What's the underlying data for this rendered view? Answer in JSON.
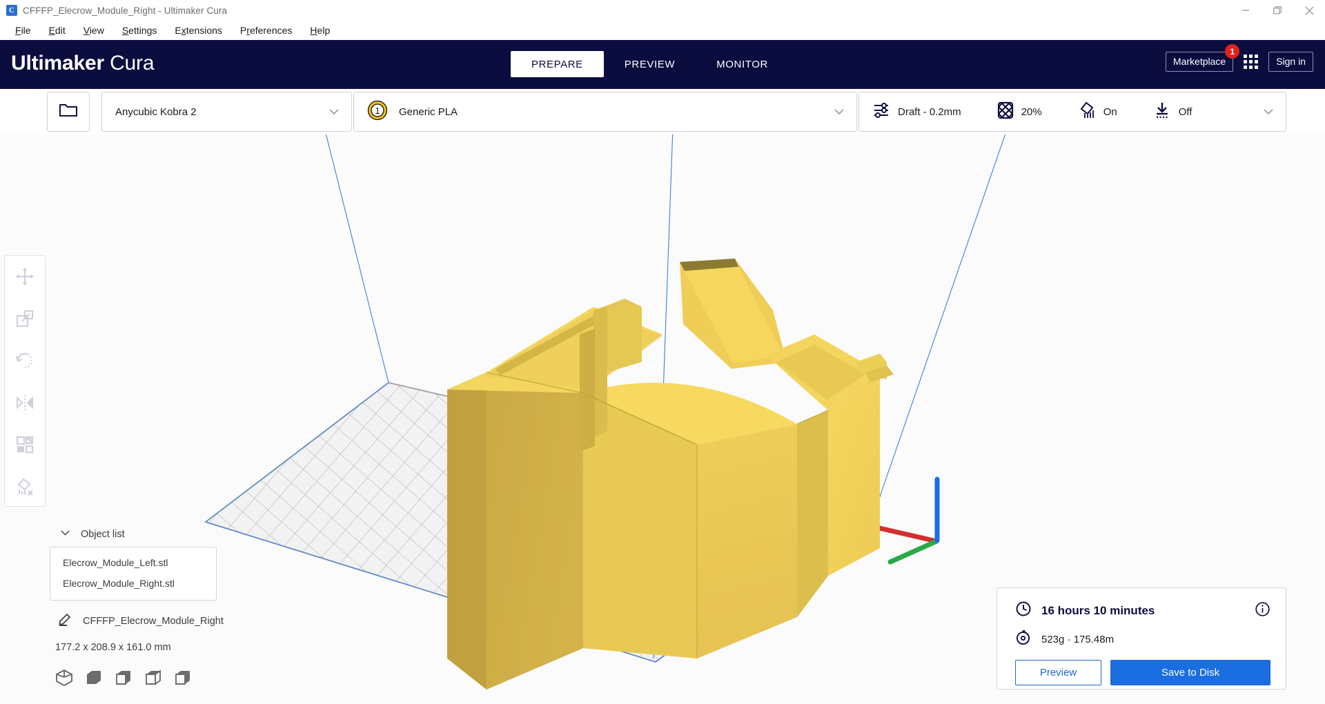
{
  "window": {
    "title": "CFFFP_Elecrow_Module_Right - Ultimaker Cura",
    "app_icon": "cura-app-icon",
    "minimize": "minimize-icon",
    "maximize": "restore-icon",
    "close": "close-icon"
  },
  "menubar": {
    "items": [
      {
        "pre": "",
        "accel": "F",
        "post": "ile"
      },
      {
        "pre": "",
        "accel": "E",
        "post": "dit"
      },
      {
        "pre": "",
        "accel": "V",
        "post": "iew"
      },
      {
        "pre": "",
        "accel": "S",
        "post": "ettings"
      },
      {
        "pre": "E",
        "accel": "x",
        "post": "tensions"
      },
      {
        "pre": "P",
        "accel": "r",
        "post": "eferences"
      },
      {
        "pre": "",
        "accel": "H",
        "post": "elp"
      }
    ]
  },
  "header": {
    "logo_bold": "Ultimaker",
    "logo_light": "Cura",
    "background_color": "#0c0d3f",
    "tabs": [
      {
        "label": "PREPARE",
        "active": true
      },
      {
        "label": "PREVIEW",
        "active": false
      },
      {
        "label": "MONITOR",
        "active": false
      }
    ],
    "marketplace_label": "Marketplace",
    "marketplace_badge": "1",
    "badge_color": "#e3211c",
    "apps_icon": "grid-apps-icon",
    "signin_label": "Sign in"
  },
  "settings_bar": {
    "open_file_icon": "folder-open-icon",
    "printer": {
      "value": "Anycubic Kobra 2",
      "chevron": "chevron-down-icon"
    },
    "material": {
      "extruder_number": "1",
      "extruder_color": "#f5c11e",
      "value": "Generic PLA",
      "chevron": "chevron-down-icon"
    },
    "print_settings": {
      "profile_icon": "sliders-icon",
      "profile_value": "Draft - 0.2mm",
      "infill_icon": "infill-grid-icon",
      "infill_value": "20%",
      "support_icon": "support-icon",
      "support_value": "On",
      "adhesion_icon": "adhesion-icon",
      "adhesion_value": "Off",
      "chevron": "chevron-down-icon"
    }
  },
  "left_toolbar": {
    "tools": [
      {
        "name": "move-tool",
        "icon": "move-icon"
      },
      {
        "name": "scale-tool",
        "icon": "scale-icon"
      },
      {
        "name": "rotate-tool",
        "icon": "rotate-icon"
      },
      {
        "name": "mirror-tool",
        "icon": "mirror-icon"
      },
      {
        "name": "per-model-settings-tool",
        "icon": "per-model-settings-icon"
      },
      {
        "name": "support-blocker-tool",
        "icon": "support-blocker-icon"
      }
    ]
  },
  "object_panel": {
    "collapse_icon": "chevron-down-icon",
    "title": "Object list",
    "items": [
      "Elecrow_Module_Left.stl",
      "Elecrow_Module_Right.stl"
    ],
    "edit_icon": "pencil-icon",
    "model_name": "CFFFP_Elecrow_Module_Right",
    "dimensions": "177.2 x 208.9 x 161.0 mm",
    "view_icons": [
      "view-iso-icon",
      "view-front-icon",
      "view-top-icon",
      "view-left-icon",
      "view-right-icon"
    ]
  },
  "print_info": {
    "time_icon": "clock-icon",
    "time": "16 hours 10 minutes",
    "material_icon": "spool-icon",
    "material": "523g · 175.48m",
    "info_icon": "info-icon",
    "preview_label": "Preview",
    "save_label": "Save to Disk",
    "accent_color": "#1a6ee0"
  },
  "viewport": {
    "background_color": "#fbfbfb",
    "model_color": "#f0cd50",
    "buildplate_color": "#f0f0f0",
    "boundary_color": "#3b7fe0",
    "axis_x_color": "#d32f2f",
    "axis_y_color": "#2ba84a",
    "axis_z_color": "#1a6ee0"
  }
}
